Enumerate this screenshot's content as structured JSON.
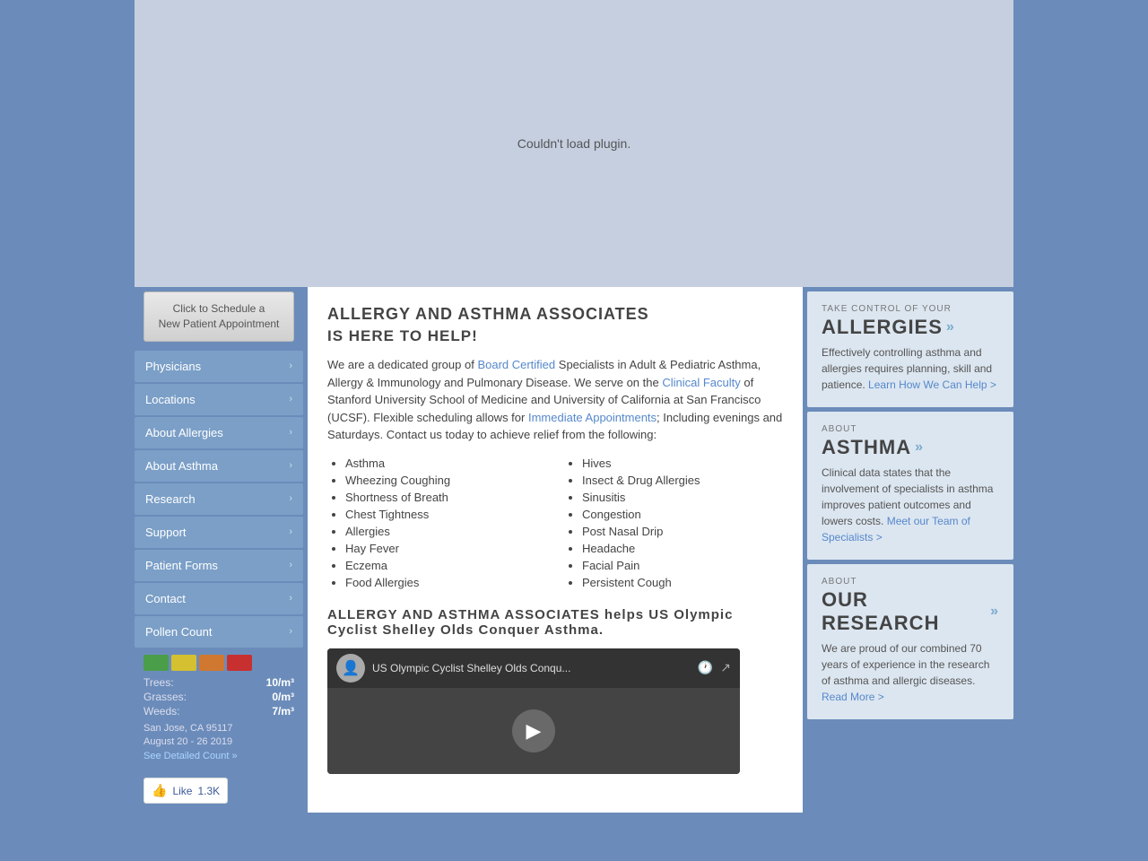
{
  "header": {
    "plugin_message": "Couldn't load plugin."
  },
  "sidebar": {
    "schedule_btn_line1": "Click to Schedule a",
    "schedule_btn_line2": "New Patient Appointment",
    "nav_items": [
      {
        "label": "Physicians",
        "id": "physicians"
      },
      {
        "label": "Locations",
        "id": "locations"
      },
      {
        "label": "About Allergies",
        "id": "about-allergies"
      },
      {
        "label": "About Asthma",
        "id": "about-asthma"
      },
      {
        "label": "Research",
        "id": "research"
      },
      {
        "label": "Support",
        "id": "support"
      },
      {
        "label": "Patient Forms",
        "id": "patient-forms"
      },
      {
        "label": "Contact",
        "id": "contact"
      },
      {
        "label": "Pollen Count",
        "id": "pollen-count"
      }
    ],
    "pollen": {
      "trees_label": "Trees:",
      "trees_value": "10/m³",
      "grasses_label": "Grasses:",
      "grasses_value": "0/m³",
      "weeds_label": "Weeds:",
      "weeds_value": "7/m³",
      "location": "San Jose, CA 95117",
      "date": "August 20 - 26 2019",
      "see_detailed": "See Detailed Count »"
    },
    "fb_like_label": "Like",
    "fb_like_count": "1.3K"
  },
  "main": {
    "title_line1": "ALLERGY AND ASTHMA ASSOCIATES",
    "title_line2": "IS HERE TO HELP!",
    "intro_text_1": "We are a dedicated group of ",
    "board_certified": "Board Certified",
    "intro_text_2": " Specialists in Adult & Pediatric Asthma, Allergy & Immunology and Pulmonary Disease. We serve on the ",
    "clinical_faculty": "Clinical Faculty",
    "intro_text_3": " of Stanford University School of Medicine and University of California at San Francisco (UCSF). Flexible scheduling allows for ",
    "immediate_appointments": "Immediate Appointments",
    "intro_text_4": "; Including evenings and Saturdays. Contact us today to achieve relief from the following:",
    "symptoms_left": [
      "Asthma",
      "Wheezing Coughing",
      "Shortness of Breath",
      "Chest Tightness",
      "Allergies",
      "Hay Fever",
      "Eczema",
      "Food Allergies"
    ],
    "symptoms_right": [
      "Hives",
      "Insect & Drug Allergies",
      "Sinusitis",
      "Congestion",
      "Post Nasal Drip",
      "Headache",
      "Facial Pain",
      "Persistent Cough"
    ],
    "section2_title": "ALLERGY AND ASTHMA ASSOCIATES helps US Olympic Cyclist Shelley Olds Conquer Asthma.",
    "video_title": "US Olympic Cyclist Shelley Olds Conqu..."
  },
  "right_sidebar": {
    "cards": [
      {
        "id": "allergies",
        "label": "TAKE CONTROL OF YOUR",
        "title": "ALLERGIES",
        "text_1": "Effectively controlling asthma and allergies requires planning, skill and patience.",
        "link_text": "Learn How We Can Help >",
        "link_id": "allergies-link"
      },
      {
        "id": "asthma",
        "label": "ABOUT",
        "title": "ASTHMA",
        "text_1": "Clinical data states that the involvement of specialists in asthma improves patient outcomes and lowers costs.",
        "link_text": "Meet our Team of Specialists >",
        "link_id": "asthma-link"
      },
      {
        "id": "research",
        "label": "ABOUT",
        "title": "OUR RESEARCH",
        "text_1": "We are proud of our combined 70 years of experience in the research of asthma and allergic diseases.",
        "link_text": "Read More >",
        "link_id": "research-link"
      }
    ]
  }
}
